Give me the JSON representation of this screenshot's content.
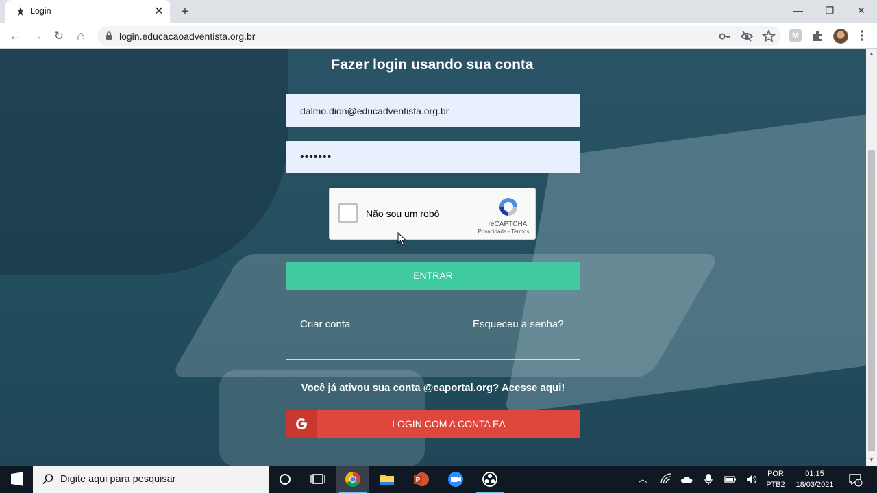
{
  "browser": {
    "tab_title": "Login",
    "tab_close": "✕",
    "new_tab": "+",
    "url": "login.educacaoadventista.org.br",
    "window": {
      "minimize": "—",
      "restore": "❐",
      "close": "✕"
    },
    "nav": {
      "back": "←",
      "forward": "→",
      "reload": "↻",
      "home": "⌂"
    },
    "ext_label": "M"
  },
  "login": {
    "title": "Fazer login usando sua conta",
    "email_value": "dalmo.dion@educadventista.org.br",
    "password_value": "•••••••",
    "recaptcha": {
      "label": "Não sou um robô",
      "brand": "reCAPTCHA",
      "links": "Privacidade - Termos"
    },
    "submit_label": "ENTRAR",
    "create_account": "Criar conta",
    "forgot_password": "Esqueceu a senha?",
    "ea_prompt": "Você já ativou sua conta @eaportal.org? Acesse aqui!",
    "ea_button_label": "LOGIN COM A CONTA EA"
  },
  "taskbar": {
    "search_placeholder": "Digite aqui para pesquisar",
    "lang_top": "POR",
    "lang_bottom": "PTB2",
    "time": "01:15",
    "date": "18/03/2021",
    "notif_count": "1"
  },
  "colors": {
    "accent_green": "#3fcaa0",
    "ea_red": "#e0473c",
    "field_bg": "#e8f0fe"
  }
}
